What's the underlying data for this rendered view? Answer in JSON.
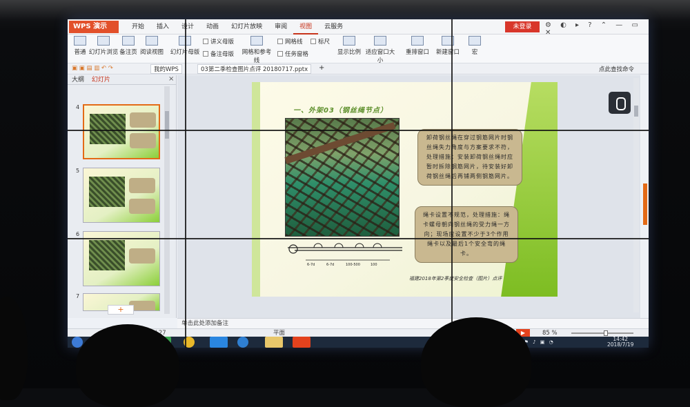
{
  "app": {
    "name": "WPS 演示",
    "menu_tabs": [
      "开始",
      "插入",
      "设计",
      "动画",
      "幻灯片放映",
      "审阅",
      "视图",
      "云服务"
    ],
    "active_tab": "视图",
    "login_label": "未登录"
  },
  "ribbon": {
    "normal": "普通",
    "slide_sorter": "幻灯片浏览",
    "notes_page": "备注页",
    "reading_view": "阅读视图",
    "slide_master": "幻灯片母版",
    "handout_master": "讲义母版",
    "notes_master": "备注母版",
    "grid_guides": "网格和参考线",
    "gridlines": "网格线",
    "ruler": "标尺",
    "task_pane": "任务窗格",
    "fit_ratio": "显示比例",
    "fit_window": "适应窗口大小",
    "arrange_window": "重排窗口",
    "new_window": "新建窗口",
    "macro": "宏"
  },
  "qat": {
    "wps_tab": "我的WPS",
    "doc_tab": "03第二季检查图片点评 20180717.pptx",
    "search": "点此查找命令"
  },
  "left_panel": {
    "outline_tab": "大纲",
    "slides_tab": "幻灯片",
    "thumb_numbers": [
      "4",
      "5",
      "6",
      "7"
    ]
  },
  "slide": {
    "title": "一、外架03（钢丝绳节点）",
    "callout1": "卸荷钢丝绳在穿过钢筋网片时钢丝绳失力角度与方案要求不符，处理措施：安装卸荷钢丝绳时应暂时拆除钢筋网片，待安装好卸荷钢丝绳后再铺两侧钢筋网片。",
    "callout2": "绳卡设置不规范，处理措施：绳卡螺母朝向钢丝绳的受力绳一方向；现场应设置不少于3个作用绳卡以及最后1个安全弯的绳卡。",
    "diagram_labels": [
      "6-7d",
      "6-7d",
      "100-500",
      "100"
    ],
    "footer": "福建2018年第2季度安全检查（图片）点评"
  },
  "notes_placeholder": "单击此处添加备注",
  "status": {
    "slide_counter": "幻灯片 4 / 27",
    "theme": "平面",
    "zoom": "85 %",
    "zoom_fraction": 0.56
  },
  "clock": {
    "time": "14:42",
    "date": "2018/7/19"
  },
  "colors": {
    "wps_orange": "#e2502a",
    "active_tab": "#c7331b",
    "slide_green": "#7dbd22",
    "callout": "#c9b890"
  }
}
